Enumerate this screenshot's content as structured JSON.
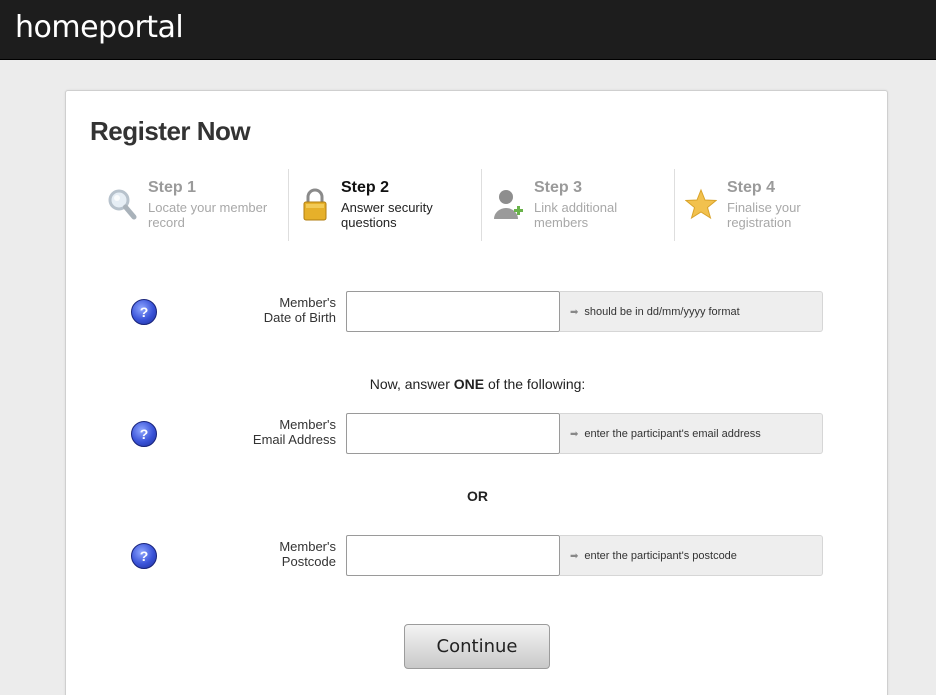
{
  "header": {
    "brand": "homeportal"
  },
  "form": {
    "title": "Register Now",
    "steps": [
      {
        "title": "Step 1",
        "desc": "Locate your member record",
        "icon": "search-icon",
        "active": false
      },
      {
        "title": "Step 2",
        "desc": "Answer security questions",
        "icon": "lock-icon",
        "active": true
      },
      {
        "title": "Step 3",
        "desc": "Link additional members",
        "icon": "add-user-icon",
        "active": false
      },
      {
        "title": "Step 4",
        "desc": "Finalise your registration",
        "icon": "star-icon",
        "active": false
      }
    ],
    "help_glyph": "?",
    "hint_arrow": "➡",
    "fields": {
      "dob": {
        "label_line1": "Member's",
        "label_line2": "Date of Birth",
        "value": "",
        "hint": "should be in dd/mm/yyyy format"
      },
      "email": {
        "label_line1": "Member's",
        "label_line2": "Email Address",
        "value": "",
        "hint": "enter the participant's email address"
      },
      "postcode": {
        "label_line1": "Member's",
        "label_line2": "Postcode",
        "value": "",
        "hint": "enter the participant's postcode"
      }
    },
    "prompt": {
      "before": "Now, answer ",
      "bold": "ONE",
      "after": " of the following:"
    },
    "or_label": "OR",
    "continue_label": "Continue"
  },
  "colors": {
    "topbar": "#1d1d1d",
    "help_blue": "#3a53d8",
    "step_active": "#111111",
    "step_inactive": "#9a9a9a"
  }
}
